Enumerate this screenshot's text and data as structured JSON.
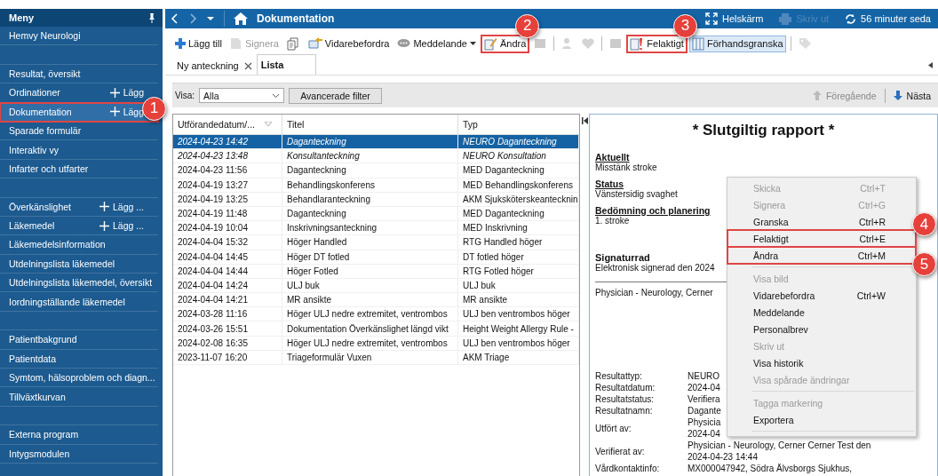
{
  "sidebar": {
    "title": "Meny",
    "items": [
      {
        "kind": "item",
        "label": "Hemvy Neurologi",
        "selected": false
      },
      {
        "kind": "spacer"
      },
      {
        "kind": "item",
        "label": "Resultat, översikt",
        "selected": false
      },
      {
        "kind": "item",
        "label": "Ordinationer",
        "add": "Lägg",
        "selected": false
      },
      {
        "kind": "item",
        "label": "Dokumentation",
        "add": "Lägg",
        "selected": true,
        "callout": "1"
      },
      {
        "kind": "item",
        "label": "Sparade formulär",
        "selected": false
      },
      {
        "kind": "item",
        "label": "Interaktiv vy",
        "selected": false
      },
      {
        "kind": "item",
        "label": "Infarter och utfarter",
        "selected": false
      },
      {
        "kind": "spacer"
      },
      {
        "kind": "item",
        "label": "Överkänslighet",
        "add": "Lägg ...",
        "selected": false
      },
      {
        "kind": "item",
        "label": "Läkemedel",
        "add": "Lägg ...",
        "selected": false
      },
      {
        "kind": "item",
        "label": "Läkemedelsinformation",
        "selected": false
      },
      {
        "kind": "item",
        "label": "Utdelningslista läkemedel",
        "selected": false
      },
      {
        "kind": "item",
        "label": "Utdelningslista läkemedel, översikt",
        "selected": false
      },
      {
        "kind": "item",
        "label": "Iordningställande läkemedel",
        "selected": false
      },
      {
        "kind": "spacer"
      },
      {
        "kind": "item",
        "label": "Patientbakgrund",
        "selected": false
      },
      {
        "kind": "item",
        "label": "Patientdata",
        "selected": false
      },
      {
        "kind": "item",
        "label": "Symtom, hälsoproblem och diagn...",
        "selected": false
      },
      {
        "kind": "item",
        "label": "Tillväxtkurvan",
        "selected": false
      },
      {
        "kind": "spacer"
      },
      {
        "kind": "item",
        "label": "Externa program",
        "selected": false
      },
      {
        "kind": "item",
        "label": "Intygsmodulen",
        "selected": false
      }
    ]
  },
  "header": {
    "title": "Dokumentation",
    "actions": [
      {
        "kind": "fullscreen",
        "label": "Helskärm",
        "disabled": false
      },
      {
        "kind": "print",
        "label": "Skriv ut",
        "disabled": true
      },
      {
        "kind": "refresh",
        "label": "56 minuter seda",
        "disabled": false
      }
    ]
  },
  "toolbar": [
    {
      "kind": "add",
      "label": "Lägg till",
      "disabled": false,
      "pressed": false
    },
    {
      "kind": "sign",
      "label": "Signera",
      "disabled": true,
      "pressed": false
    },
    {
      "kind": "documents",
      "disabled": false,
      "pressed": false
    },
    {
      "kind": "forward",
      "label": "Vidarebefordra",
      "disabled": false,
      "pressed": false
    },
    {
      "kind": "message",
      "label": "Meddelande",
      "dropdown": true,
      "disabled": false,
      "pressed": false
    },
    {
      "kind": "edit",
      "label": "Ändra",
      "disabled": false,
      "pressed": false,
      "callout": "2"
    },
    {
      "kind": "block",
      "disabled": true,
      "pressed": false
    },
    {
      "kind": "separator"
    },
    {
      "kind": "person",
      "disabled": true,
      "pressed": false
    },
    {
      "kind": "heart",
      "disabled": true,
      "pressed": false
    },
    {
      "kind": "separator"
    },
    {
      "kind": "block",
      "disabled": true,
      "pressed": false
    },
    {
      "kind": "flag",
      "label": "Felaktigt",
      "disabled": false,
      "pressed": false,
      "callout": "3"
    },
    {
      "kind": "preview",
      "label": "Förhandsgranska",
      "disabled": false,
      "pressed": true
    },
    {
      "kind": "separator"
    },
    {
      "kind": "tag",
      "disabled": true,
      "pressed": false
    }
  ],
  "tabs": [
    {
      "label": "Ny anteckning",
      "closable": true,
      "selected": false
    },
    {
      "label": "Lista",
      "closable": false,
      "selected": true
    }
  ],
  "filter": {
    "label": "Visa:",
    "value": "Alla",
    "button": "Avancerade filter",
    "previous": {
      "label": "Föregående",
      "disabled": true
    },
    "next": {
      "label": "Nästa",
      "disabled": false
    }
  },
  "table": {
    "columns": [
      "Utförandedatum/...",
      "Titel",
      "Typ"
    ],
    "rows": [
      {
        "date": "2024-04-23 14:42",
        "title": "Daganteckning",
        "type": "NEURO Daganteckning",
        "italic": true,
        "selected": true
      },
      {
        "date": "2024-04-23 13:48",
        "title": "Konsultanteckning",
        "type": "NEURO Konsultation",
        "italic": true,
        "selected": false
      },
      {
        "date": "2024-04-23 11:56",
        "title": "Daganteckning",
        "type": "MED Daganteckning",
        "italic": false,
        "selected": false
      },
      {
        "date": "2024-04-19 13:27",
        "title": "Behandlingskonferens",
        "type": "MED Behandlingskonferens",
        "italic": false,
        "selected": false
      },
      {
        "date": "2024-04-19 13:25",
        "title": "Behandlaranteckning",
        "type": "AKM Sjuksköterskeantecknin",
        "italic": false,
        "selected": false
      },
      {
        "date": "2024-04-19 11:48",
        "title": "Daganteckning",
        "type": "MED Daganteckning",
        "italic": false,
        "selected": false
      },
      {
        "date": "2024-04-19 10:04",
        "title": "Inskrivningsanteckning",
        "type": "MED Inskrivning",
        "italic": false,
        "selected": false
      },
      {
        "date": "2024-04-04 15:32",
        "title": "Höger Handled",
        "type": "RTG Handled höger",
        "italic": false,
        "selected": false
      },
      {
        "date": "2024-04-04 14:45",
        "title": "Höger DT fotled",
        "type": "DT fotled höger",
        "italic": false,
        "selected": false
      },
      {
        "date": "2024-04-04 14:44",
        "title": "Höger Fotled",
        "type": "RTG Fotled höger",
        "italic": false,
        "selected": false
      },
      {
        "date": "2024-04-04 14:24",
        "title": "ULJ buk",
        "type": "ULJ buk",
        "italic": false,
        "selected": false
      },
      {
        "date": "2024-04-04 14:21",
        "title": "MR ansikte",
        "type": "MR ansikte",
        "italic": false,
        "selected": false
      },
      {
        "date": "2024-03-28 11:16",
        "title": "Höger ULJ nedre extremitet, ventrombos",
        "type": "ULJ ben ventrombos höger",
        "italic": false,
        "selected": false
      },
      {
        "date": "2024-03-26 15:51",
        "title": "Dokumentation Överkänslighet längd vikt",
        "type": "Height Weight Allergy Rule -",
        "italic": false,
        "selected": false
      },
      {
        "date": "2024-02-08 16:35",
        "title": "Höger ULJ nedre extremitet, ventrombos",
        "type": "ULJ ben ventrombos höger",
        "italic": false,
        "selected": false
      },
      {
        "date": "2023-11-07 16:20",
        "title": "Triageformulär Vuxen",
        "type": "AKM Triage",
        "italic": false,
        "selected": false
      }
    ]
  },
  "report": {
    "title": "* Slutgiltig rapport *",
    "sections": [
      {
        "heading": "Aktuellt",
        "text": "Misstänk stroke"
      },
      {
        "heading": "Status",
        "text": "Vänstersidig svaghet"
      },
      {
        "heading": "Bedömning och planering",
        "text": "1. stroke"
      }
    ],
    "signature": {
      "heading": "Signaturrad",
      "text": "Elektronisk signerad den 2024",
      "author": "Physician - Neurology, Cerner"
    },
    "details": [
      {
        "label": "Resultattyp:",
        "values": [
          "NEURO"
        ]
      },
      {
        "label": "Resultatdatum:",
        "values": [
          "2024-04"
        ]
      },
      {
        "label": "Resultatstatus:",
        "values": [
          "Verifiera"
        ]
      },
      {
        "label": "Resultatnamn:",
        "values": [
          "Dagante"
        ]
      },
      {
        "label": "Utfört av:",
        "values": [
          "Physicia",
          "2024-04"
        ]
      },
      {
        "label": "Verifierat av:",
        "values": [
          "Physician - Neurology, Cerner Cerner Test den",
          "2024-04-23 14:44"
        ]
      },
      {
        "label": "Vårdkontaktinfo:",
        "values": [
          "MX000047942, Södra Älvsborgs Sjukhus,"
        ]
      }
    ]
  },
  "context_menu": [
    {
      "kind": "item",
      "label": "Skicka",
      "shortcut": "Ctrl+T",
      "disabled": true
    },
    {
      "kind": "item",
      "label": "Signera",
      "shortcut": "Ctrl+G",
      "disabled": true
    },
    {
      "kind": "item",
      "label": "Granska",
      "shortcut": "Ctrl+R",
      "disabled": false
    },
    {
      "kind": "item",
      "label": "Felaktigt",
      "shortcut": "Ctrl+E",
      "disabled": false,
      "callout": "4"
    },
    {
      "kind": "item",
      "label": "Ändra",
      "shortcut": "Ctrl+M",
      "disabled": false,
      "callout": "5"
    },
    {
      "kind": "separator"
    },
    {
      "kind": "item",
      "label": "Visa bild",
      "disabled": true
    },
    {
      "kind": "item",
      "label": "Vidarebefordra",
      "shortcut": "Ctrl+W",
      "disabled": false
    },
    {
      "kind": "item",
      "label": "Meddelande",
      "disabled": false
    },
    {
      "kind": "item",
      "label": "Personalbrev",
      "disabled": false
    },
    {
      "kind": "item",
      "label": "Skriv ut",
      "disabled": true
    },
    {
      "kind": "item",
      "label": "Visa historik",
      "disabled": false
    },
    {
      "kind": "item",
      "label": "Visa spårade ändringar",
      "disabled": true
    },
    {
      "kind": "separator"
    },
    {
      "kind": "item",
      "label": "Tagga markering",
      "disabled": true
    },
    {
      "kind": "item",
      "label": "Exportera",
      "disabled": false
    }
  ]
}
